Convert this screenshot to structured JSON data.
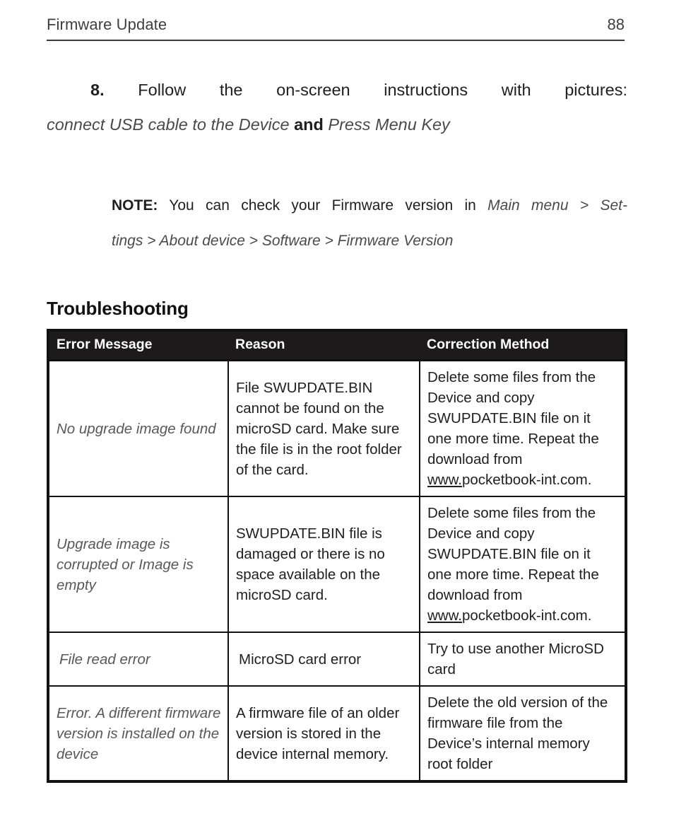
{
  "header": {
    "title": "Firmware Update",
    "page_number": "88"
  },
  "body": {
    "step_number": "8.",
    "step_text_part1": "Follow the on-screen instructions with pictures:",
    "step_italic_1": "connect USB cable to the Device",
    "step_conjunction": "and",
    "step_italic_2": "Press Menu Key",
    "note_label": "NOTE:",
    "note_text": "You can check your Firmware version in",
    "note_path": "Main menu > Settings > About device > Software > Firmware Version",
    "note_path_line1": "Main menu > Set-",
    "note_path_line2": "tings > About device > Software > Firmware Version"
  },
  "section": {
    "heading": "Troubleshooting"
  },
  "table": {
    "columns": [
      "Error Message",
      "Reason",
      "Correction Method"
    ],
    "rows": [
      {
        "error": "No upgrade image found",
        "reason": "File SWUPDATE.BIN cannot be found on the microSD card. Make sure the file is in the root folder of the card.",
        "correction_prefix": "Delete some files from the Device and copy SWUPDATE.BIN file on it one more time. Repeat the download from ",
        "correction_link_underlined": "www.",
        "correction_link_rest": "pocketbook-int.com."
      },
      {
        "error": "Upgrade image is corrupted or Image is empty",
        "reason": "SWUPDATE.BIN file is damaged or there is no space available on the microSD card.",
        "correction_prefix": "Delete some files from the Device and copy SWUPDATE.BIN file on it one more time. Repeat the download from ",
        "correction_link_underlined": "www.",
        "correction_link_rest": "pocketbook-int.com."
      },
      {
        "error": "File read error",
        "reason": "MicroSD card error",
        "correction": "Try to use another MicroSD card"
      },
      {
        "error": "Error. A different firmware version is installed on the device",
        "reason": "A firmware file of an older version is stored in the device internal memory.",
        "correction": "Delete the old version of the firmware file from the Device’s internal memory root folder"
      }
    ]
  },
  "colors": {
    "header_bg": "#1c1a1a",
    "header_text": "#ffffff",
    "border": "#111111",
    "italic_text": "#585858",
    "body_text": "#1f1f1f",
    "running_head": "#3f3f3f"
  }
}
